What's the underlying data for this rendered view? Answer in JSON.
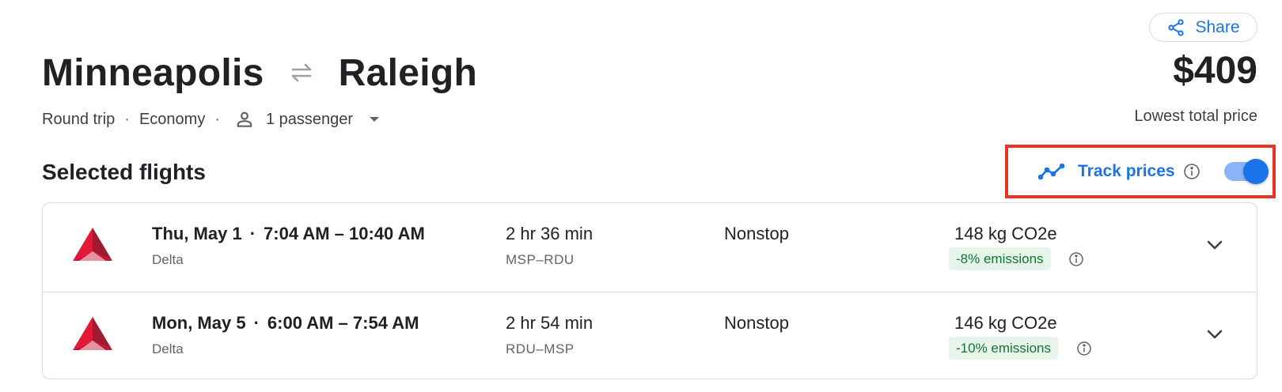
{
  "header": {
    "origin": "Minneapolis",
    "destination": "Raleigh",
    "swap_icon": "round-trip-arrows-icon",
    "share_label": "Share",
    "share_icon": "share-icon",
    "price": "$409",
    "price_label": "Lowest total price"
  },
  "trip": {
    "type": "Round trip",
    "cabin": "Economy",
    "passengers": "1 passenger",
    "separator": "·"
  },
  "section": {
    "title": "Selected flights"
  },
  "track": {
    "label": "Track prices",
    "enabled": true,
    "icon": "trend-line-icon",
    "highlight_color": "#ea3323"
  },
  "flights": [
    {
      "date": "Thu, May 1",
      "times": "7:04 AM – 10:40 AM",
      "airline": "Delta",
      "duration": "2 hr 36 min",
      "route": "MSP–RDU",
      "stops": "Nonstop",
      "co2": "148 kg CO2e",
      "emissions": "-8% emissions"
    },
    {
      "date": "Mon, May 5",
      "times": "6:00 AM – 7:54 AM",
      "airline": "Delta",
      "duration": "2 hr 54 min",
      "route": "RDU–MSP",
      "stops": "Nonstop",
      "co2": "146 kg CO2e",
      "emissions": "-10% emissions"
    }
  ],
  "colors": {
    "accent": "#1a73e8",
    "emissions_bg": "#e6f4ea",
    "emissions_text": "#137333",
    "delta_red": "#c8102e"
  }
}
